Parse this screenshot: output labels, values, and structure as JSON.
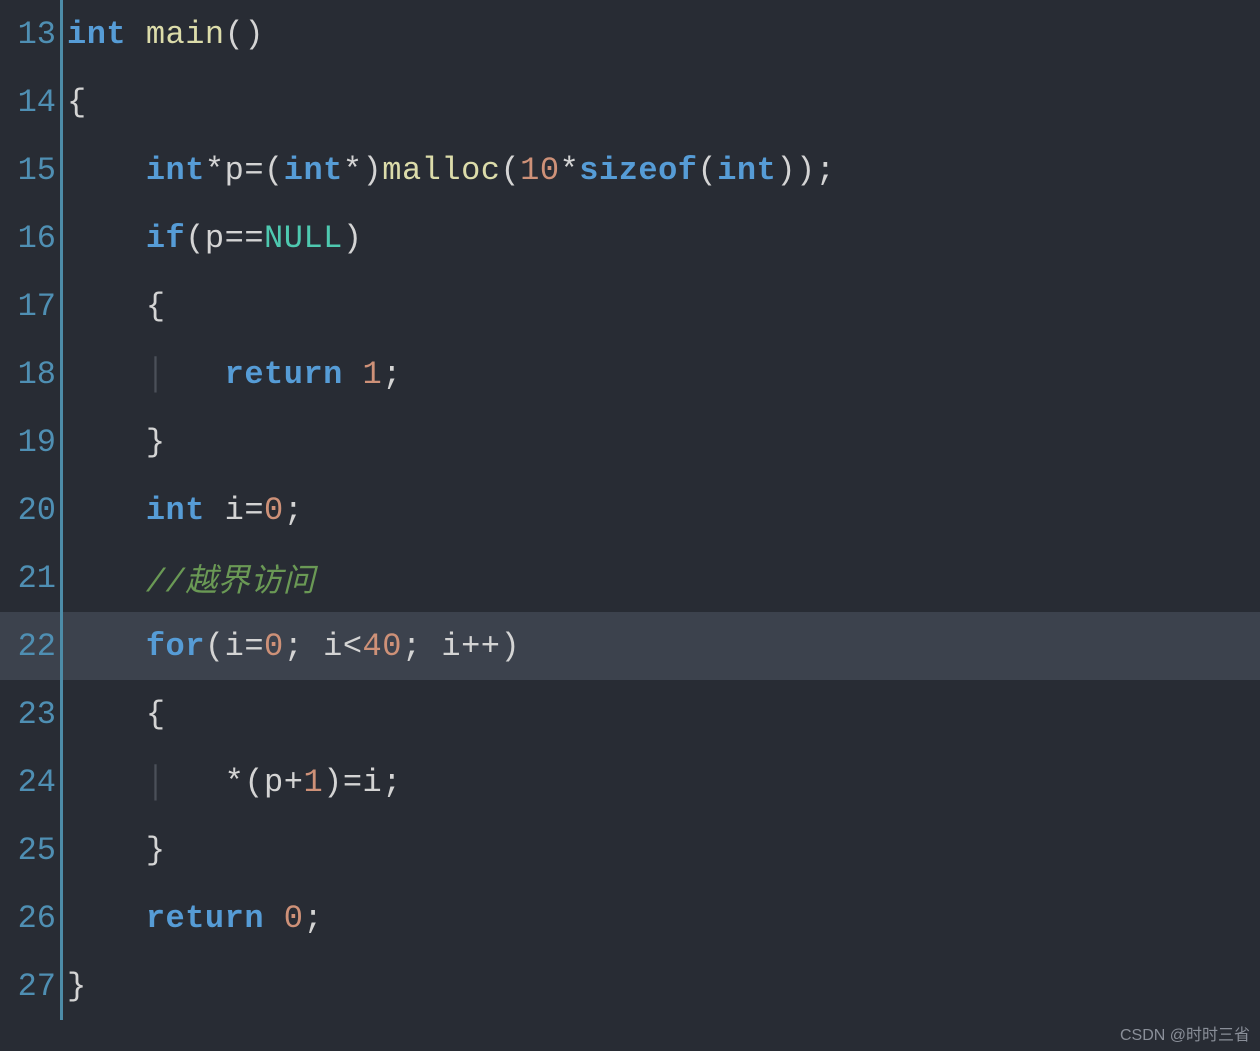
{
  "watermark": "CSDN @时时三省",
  "lines": [
    {
      "num": "13",
      "highlighted": false,
      "tokens": [
        {
          "cls": "kw",
          "t": "int"
        },
        {
          "cls": "punc",
          "t": " "
        },
        {
          "cls": "fn",
          "t": "main"
        },
        {
          "cls": "punc",
          "t": "()"
        }
      ]
    },
    {
      "num": "14",
      "highlighted": false,
      "tokens": [
        {
          "cls": "punc",
          "t": "{"
        }
      ]
    },
    {
      "num": "15",
      "highlighted": false,
      "tokens": [
        {
          "cls": "punc",
          "t": "    "
        },
        {
          "cls": "kw",
          "t": "int"
        },
        {
          "cls": "op",
          "t": "*"
        },
        {
          "cls": "ident",
          "t": "p"
        },
        {
          "cls": "op",
          "t": "="
        },
        {
          "cls": "punc",
          "t": "("
        },
        {
          "cls": "kw",
          "t": "int"
        },
        {
          "cls": "op",
          "t": "*"
        },
        {
          "cls": "punc",
          "t": ")"
        },
        {
          "cls": "fn",
          "t": "malloc"
        },
        {
          "cls": "punc",
          "t": "("
        },
        {
          "cls": "num",
          "t": "10"
        },
        {
          "cls": "op",
          "t": "*"
        },
        {
          "cls": "kw",
          "t": "sizeof"
        },
        {
          "cls": "punc",
          "t": "("
        },
        {
          "cls": "kw",
          "t": "int"
        },
        {
          "cls": "punc",
          "t": "));"
        }
      ]
    },
    {
      "num": "16",
      "highlighted": false,
      "tokens": [
        {
          "cls": "punc",
          "t": "    "
        },
        {
          "cls": "kw",
          "t": "if"
        },
        {
          "cls": "punc",
          "t": "("
        },
        {
          "cls": "ident",
          "t": "p"
        },
        {
          "cls": "op",
          "t": "=="
        },
        {
          "cls": "const",
          "t": "NULL"
        },
        {
          "cls": "punc",
          "t": ")"
        }
      ]
    },
    {
      "num": "17",
      "highlighted": false,
      "tokens": [
        {
          "cls": "punc",
          "t": "    {"
        }
      ]
    },
    {
      "num": "18",
      "highlighted": false,
      "tokens": [
        {
          "cls": "punc",
          "t": "    "
        },
        {
          "cls": "indent-guide",
          "t": "│"
        },
        {
          "cls": "punc",
          "t": "   "
        },
        {
          "cls": "kw",
          "t": "return"
        },
        {
          "cls": "punc",
          "t": " "
        },
        {
          "cls": "num",
          "t": "1"
        },
        {
          "cls": "punc",
          "t": ";"
        }
      ]
    },
    {
      "num": "19",
      "highlighted": false,
      "tokens": [
        {
          "cls": "punc",
          "t": "    }"
        }
      ]
    },
    {
      "num": "20",
      "highlighted": false,
      "tokens": [
        {
          "cls": "punc",
          "t": "    "
        },
        {
          "cls": "kw",
          "t": "int"
        },
        {
          "cls": "punc",
          "t": " "
        },
        {
          "cls": "ident",
          "t": "i"
        },
        {
          "cls": "op",
          "t": "="
        },
        {
          "cls": "num",
          "t": "0"
        },
        {
          "cls": "punc",
          "t": ";"
        }
      ]
    },
    {
      "num": "21",
      "highlighted": false,
      "tokens": [
        {
          "cls": "punc",
          "t": "    "
        },
        {
          "cls": "comment",
          "t": "//越界访问"
        }
      ]
    },
    {
      "num": "22",
      "highlighted": true,
      "tokens": [
        {
          "cls": "punc",
          "t": "    "
        },
        {
          "cls": "kw",
          "t": "for"
        },
        {
          "cls": "punc",
          "t": "("
        },
        {
          "cls": "ident",
          "t": "i"
        },
        {
          "cls": "op",
          "t": "="
        },
        {
          "cls": "num",
          "t": "0"
        },
        {
          "cls": "punc",
          "t": "; "
        },
        {
          "cls": "ident",
          "t": "i"
        },
        {
          "cls": "op",
          "t": "<"
        },
        {
          "cls": "num",
          "t": "40"
        },
        {
          "cls": "punc",
          "t": "; "
        },
        {
          "cls": "ident",
          "t": "i"
        },
        {
          "cls": "op",
          "t": "++"
        },
        {
          "cls": "punc",
          "t": ")"
        }
      ]
    },
    {
      "num": "23",
      "highlighted": false,
      "tokens": [
        {
          "cls": "punc",
          "t": "    {"
        }
      ]
    },
    {
      "num": "24",
      "highlighted": false,
      "tokens": [
        {
          "cls": "punc",
          "t": "    "
        },
        {
          "cls": "indent-guide",
          "t": "│"
        },
        {
          "cls": "punc",
          "t": "   "
        },
        {
          "cls": "op",
          "t": "*"
        },
        {
          "cls": "punc",
          "t": "("
        },
        {
          "cls": "ident",
          "t": "p"
        },
        {
          "cls": "op",
          "t": "+"
        },
        {
          "cls": "num",
          "t": "1"
        },
        {
          "cls": "punc",
          "t": ")"
        },
        {
          "cls": "op",
          "t": "="
        },
        {
          "cls": "ident",
          "t": "i"
        },
        {
          "cls": "punc",
          "t": ";"
        }
      ]
    },
    {
      "num": "25",
      "highlighted": false,
      "tokens": [
        {
          "cls": "punc",
          "t": "    }"
        }
      ]
    },
    {
      "num": "26",
      "highlighted": false,
      "tokens": [
        {
          "cls": "punc",
          "t": "    "
        },
        {
          "cls": "kw",
          "t": "return"
        },
        {
          "cls": "punc",
          "t": " "
        },
        {
          "cls": "num",
          "t": "0"
        },
        {
          "cls": "punc",
          "t": ";"
        }
      ]
    },
    {
      "num": "27",
      "highlighted": false,
      "tokens": [
        {
          "cls": "punc",
          "t": "}"
        }
      ]
    }
  ]
}
